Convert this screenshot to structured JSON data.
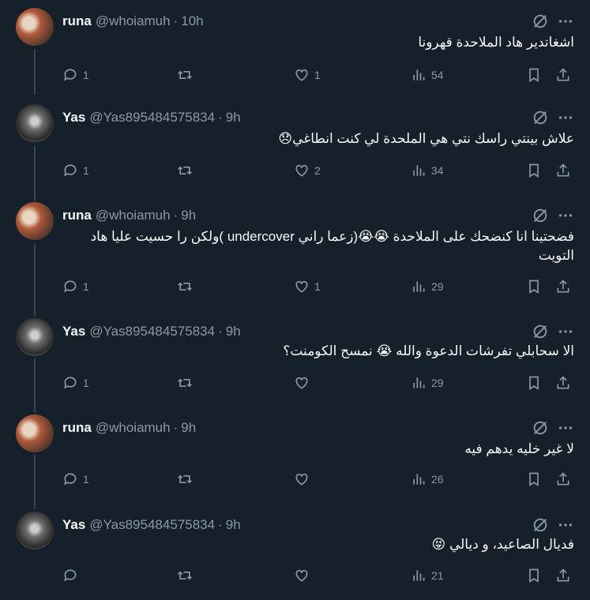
{
  "tweets": [
    {
      "name": "runa",
      "handle": "@whoiamuh",
      "time": "10h",
      "avatar": "runa",
      "text": "اشغاتدير هاد الملاحدة قهرونا",
      "replies": "1",
      "retweets": "",
      "likes": "1",
      "views": "54"
    },
    {
      "name": "Yas",
      "handle": "@Yas895484575834",
      "time": "9h",
      "avatar": "yas",
      "text": "علاش بينتي راسك نتي هي الملحدة لي كنت انطاغي😞",
      "replies": "1",
      "retweets": "",
      "likes": "2",
      "views": "34"
    },
    {
      "name": "runa",
      "handle": "@whoiamuh",
      "time": "9h",
      "avatar": "runa",
      "text": "فضحتينا انا كنضحك على الملاحدة 😭😭(زعما راني undercover )ولكن را حسيت عليا هاد التويت",
      "replies": "1",
      "retweets": "",
      "likes": "1",
      "views": "29"
    },
    {
      "name": "Yas",
      "handle": "@Yas895484575834",
      "time": "9h",
      "avatar": "yas",
      "text": "الا سحابلي تفرشات الدعوة والله 😭 نمسح الكومنت؟",
      "replies": "1",
      "retweets": "",
      "likes": "",
      "views": "29"
    },
    {
      "name": "runa",
      "handle": "@whoiamuh",
      "time": "9h",
      "avatar": "runa",
      "text": "لا غير خليه يدهم فيه",
      "replies": "1",
      "retweets": "",
      "likes": "",
      "views": "26"
    },
    {
      "name": "Yas",
      "handle": "@Yas895484575834",
      "time": "9h",
      "avatar": "yas",
      "text": "فديال الصاعيد، و ديالي 😝",
      "replies": "",
      "retweets": "",
      "likes": "",
      "views": "21"
    }
  ],
  "icons": {
    "grok": "grok-icon",
    "more": "more-icon",
    "reply": "reply-icon",
    "retweet": "retweet-icon",
    "like": "like-icon",
    "views": "views-icon",
    "bookmark": "bookmark-icon",
    "share": "share-icon"
  },
  "colors": {
    "background": "#15202b",
    "text": "#f7f9f9",
    "muted": "#8b98a5",
    "thread_line": "#38444d"
  }
}
